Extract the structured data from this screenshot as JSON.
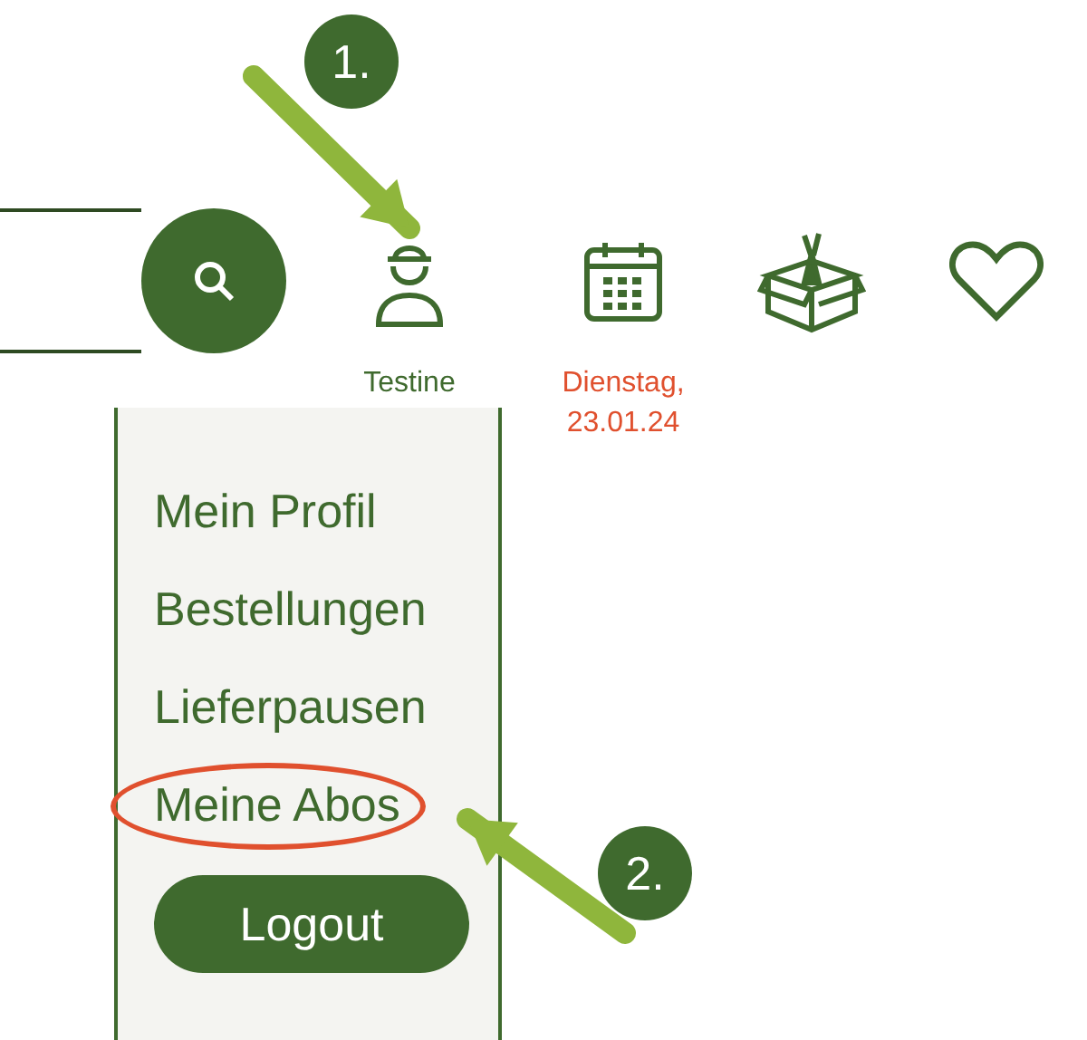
{
  "header_items": [
    {
      "kind": "user",
      "label": "Testine"
    },
    {
      "kind": "calendar",
      "label": "Dienstag, 23.01.24"
    },
    {
      "kind": "box"
    },
    {
      "kind": "heart"
    }
  ],
  "account_menu": {
    "items": [
      {
        "label": "Mein Profil",
        "circled": false
      },
      {
        "label": "Bestellungen",
        "circled": false
      },
      {
        "label": "Lieferpausen",
        "circled": false
      },
      {
        "label": "Meine Abos",
        "circled": true
      }
    ],
    "logout": "Logout"
  },
  "annotations": [
    {
      "label": "1."
    },
    {
      "label": "2."
    }
  ]
}
